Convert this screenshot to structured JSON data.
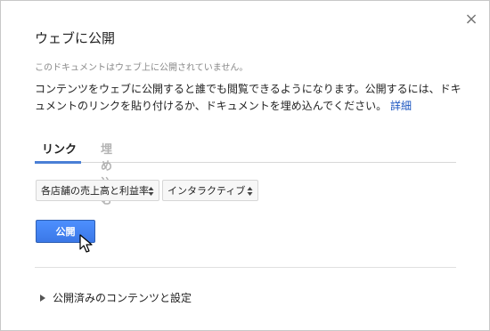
{
  "dialog": {
    "title": "ウェブに公開",
    "close_glyph": "×",
    "status": "このドキュメントはウェブ上に公開されていません。",
    "description": "コンテンツをウェブに公開すると誰でも閲覧できるようになります。公開するには、ドキュメントのリンクを貼り付けるか、ドキュメントを埋め込んでください。",
    "details_link": "詳細"
  },
  "tabs": [
    {
      "label": "リンク",
      "active": true
    },
    {
      "label": "埋め込む",
      "active": false
    }
  ],
  "selects": {
    "document": "各店舗の売上高と利益率",
    "mode": "インタラクティブ"
  },
  "publish_button": "公開",
  "expander_label": "公開済みのコンテンツと設定",
  "colors": {
    "accent": "#4a7fd6",
    "button": "#4d90fe",
    "link": "#1a55c0"
  }
}
